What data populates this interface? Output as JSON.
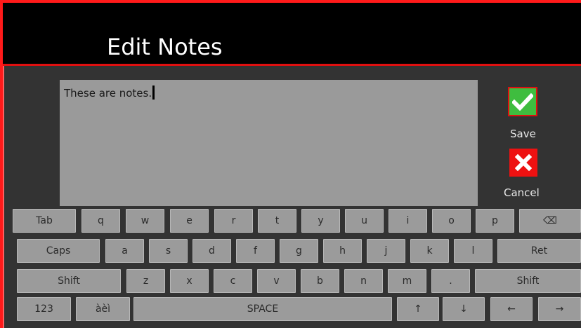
{
  "header": {
    "title": "Edit Notes"
  },
  "notes": {
    "text": "These are notes."
  },
  "actions": {
    "save_label": "Save",
    "cancel_label": "Cancel"
  },
  "colors": {
    "accent_red": "#ff1a1a",
    "save_green": "#3fbd3f",
    "cancel_red": "#ee1111",
    "key_gray": "#9b9b9b",
    "background": "#333333"
  },
  "keyboard": {
    "row1": [
      "Tab",
      "q",
      "w",
      "e",
      "r",
      "t",
      "y",
      "u",
      "i",
      "o",
      "p",
      "⌫"
    ],
    "row2": [
      "Caps",
      "a",
      "s",
      "d",
      "f",
      "g",
      "h",
      "j",
      "k",
      "l",
      "Ret"
    ],
    "row3": [
      "Shift",
      "z",
      "x",
      "c",
      "v",
      "b",
      "n",
      "m",
      ".",
      "Shift"
    ],
    "row4": [
      "123",
      "àèì",
      "SPACE",
      "↑",
      "↓",
      "←",
      "→"
    ]
  }
}
